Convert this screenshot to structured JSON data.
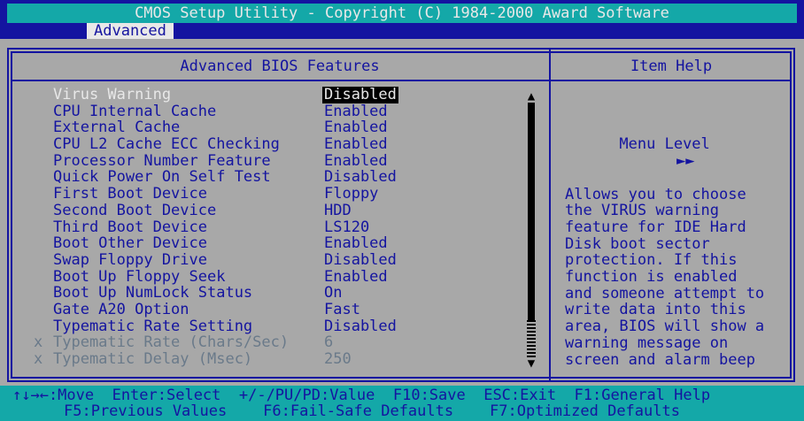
{
  "window": {
    "title": "CMOS Setup Utility - Copyright (C) 1984-2000 Award Software",
    "menu_tab": "Advanced"
  },
  "panel": {
    "heading": "Advanced BIOS Features",
    "help_heading": "Item Help"
  },
  "settings": [
    {
      "label": "Virus Warning",
      "value": "Disabled",
      "state": "selected"
    },
    {
      "label": "CPU Internal Cache",
      "value": "Enabled",
      "state": "normal"
    },
    {
      "label": "External Cache",
      "value": "Enabled",
      "state": "normal"
    },
    {
      "label": "CPU L2 Cache ECC Checking",
      "value": "Enabled",
      "state": "normal"
    },
    {
      "label": "Processor Number Feature",
      "value": "Enabled",
      "state": "normal"
    },
    {
      "label": "Quick Power On Self Test",
      "value": "Disabled",
      "state": "normal"
    },
    {
      "label": "First Boot Device",
      "value": "Floppy",
      "state": "normal"
    },
    {
      "label": "Second Boot Device",
      "value": "HDD",
      "state": "normal"
    },
    {
      "label": "Third Boot Device",
      "value": "LS120",
      "state": "normal"
    },
    {
      "label": "Boot Other Device",
      "value": "Enabled",
      "state": "normal"
    },
    {
      "label": "Swap Floppy Drive",
      "value": "Disabled",
      "state": "normal"
    },
    {
      "label": "Boot Up Floppy Seek",
      "value": "Enabled",
      "state": "normal"
    },
    {
      "label": "Boot Up NumLock Status",
      "value": "On",
      "state": "normal"
    },
    {
      "label": "Gate A20 Option",
      "value": "Fast",
      "state": "normal"
    },
    {
      "label": "Typematic Rate Setting",
      "value": "Disabled",
      "state": "normal"
    },
    {
      "label": "Typematic Rate (Chars/Sec)",
      "value": "6",
      "state": "disabled"
    },
    {
      "label": "Typematic Delay (Msec)",
      "value": "250",
      "state": "disabled"
    }
  ],
  "disabled_marker": "x",
  "help": {
    "menu_level_label": "Menu Level",
    "menu_level_arrows": "►►",
    "text": "Allows you to choose\nthe VIRUS warning\nfeature for IDE Hard\nDisk boot sector\nprotection. If this\nfunction is enabled\nand someone attempt to\nwrite data into this\narea, BIOS will show a\nwarning message on\nscreen and alarm beep"
  },
  "scrollbar": {
    "up_glyph": "▲",
    "down_glyph": "▼"
  },
  "footer": {
    "line1": "↑↓→←:Move  Enter:Select  +/-/PU/PD:Value  F10:Save  ESC:Exit  F1:General Help",
    "line2": "F5:Previous Values    F6:Fail-Safe Defaults    F7:Optimized Defaults"
  },
  "colors": {
    "background": "#a8a8a8",
    "bios_blue": "#1414a0",
    "bios_cyan": "#14a8a8",
    "highlight_text": "#e8e8e8",
    "disabled_text": "#6a7a8a"
  }
}
